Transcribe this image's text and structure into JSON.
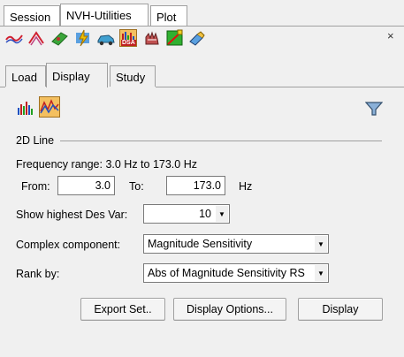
{
  "top_tabs": [
    "Session",
    "NVH-Utilities",
    "Plot"
  ],
  "toolbar": {
    "icons": [
      "curve-icon",
      "wave-icon",
      "panel-icon",
      "lightning-icon",
      "car-icon",
      "dsa-icon",
      "hand-icon",
      "diagonal-icon",
      "eraser-icon"
    ],
    "dsa_label": "DSA",
    "close_label": "×"
  },
  "sub_tabs": [
    "Load",
    "Display",
    "Study"
  ],
  "section_title": "2D Line",
  "frequency": {
    "range_label": "Frequency range: 3.0 Hz to 173.0 Hz",
    "from_label": "From:",
    "from_value": "3.0",
    "to_label": "To:",
    "to_value": "173.0",
    "unit": "Hz"
  },
  "show_highest": {
    "label": "Show highest Des Var:",
    "value": "10"
  },
  "complex_component": {
    "label": "Complex component:",
    "value": "Magnitude Sensitivity"
  },
  "rank_by": {
    "label": "Rank by:",
    "value": "Abs of Magnitude Sensitivity RS"
  },
  "buttons": {
    "export": "Export Set..",
    "display_options": "Display Options...",
    "display": "Display"
  }
}
